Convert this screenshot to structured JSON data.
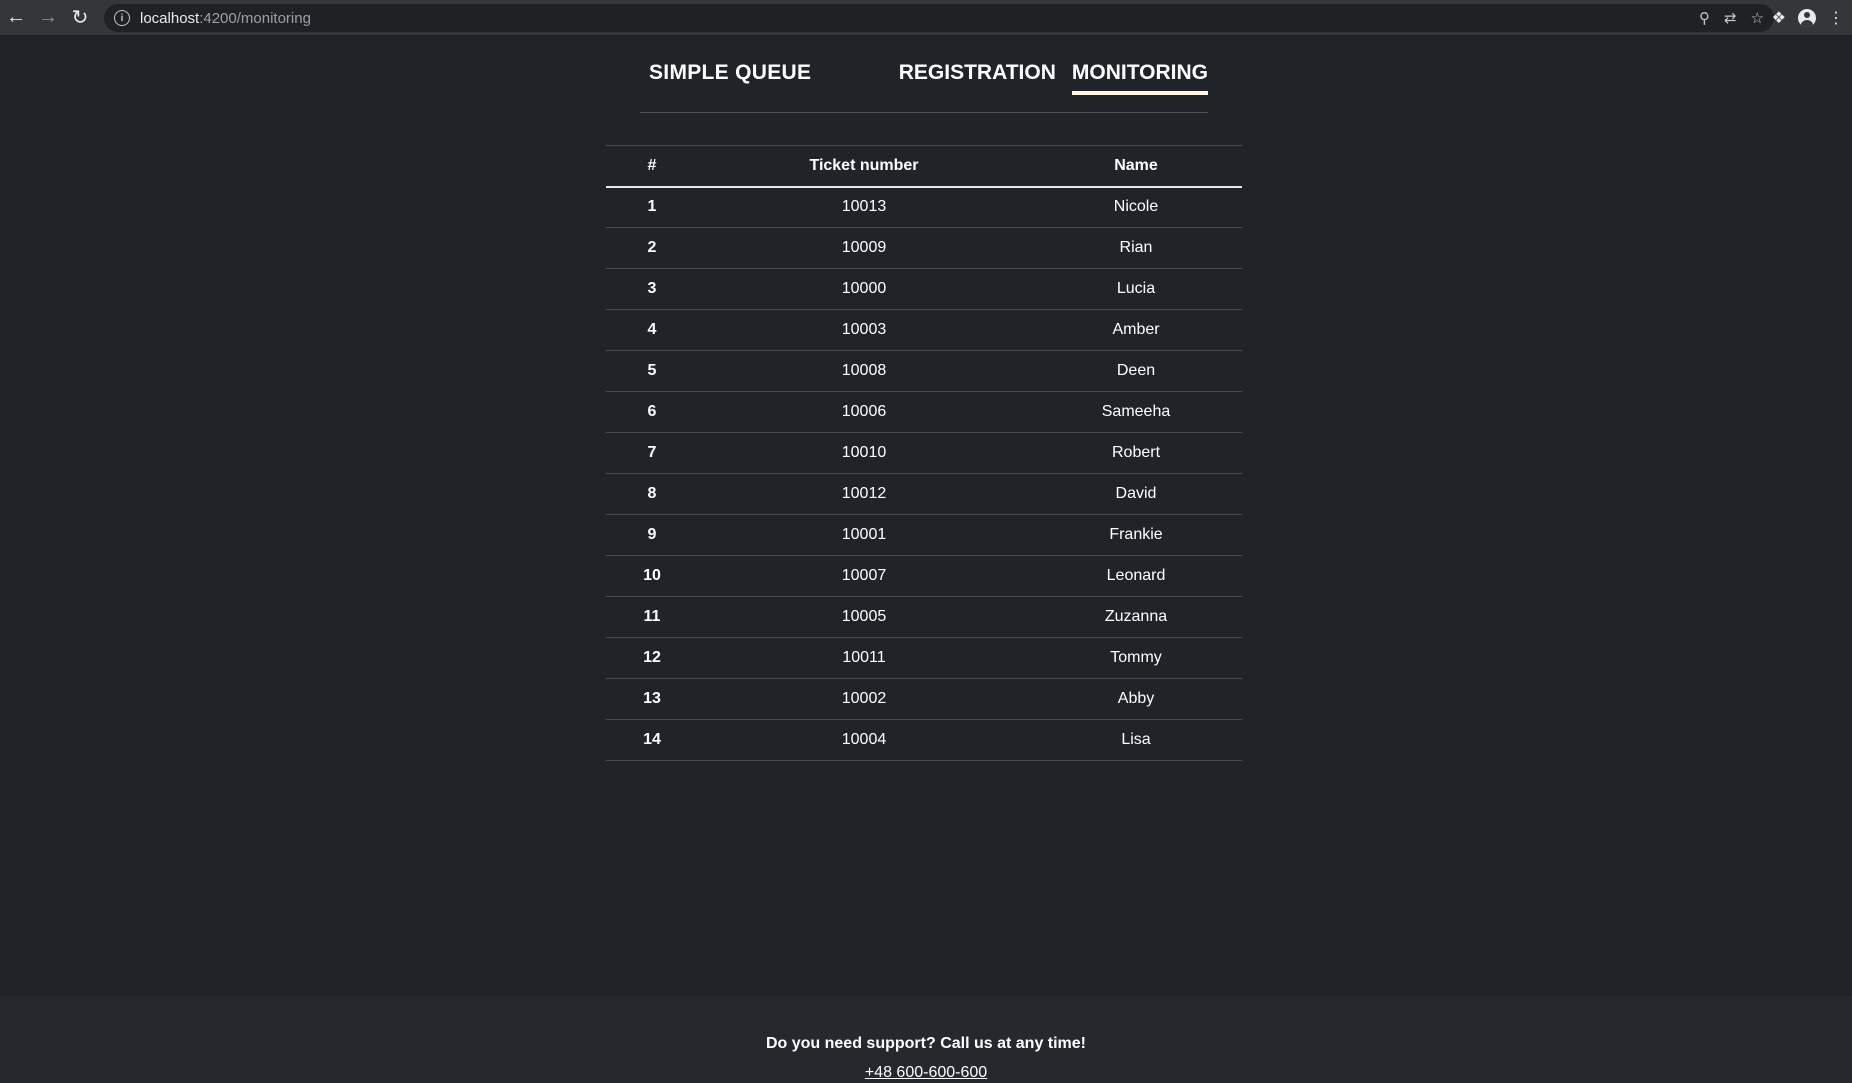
{
  "browser": {
    "url_host": "localhost",
    "url_rest": ":4200/monitoring"
  },
  "header": {
    "brand": "SIMPLE QUEUE",
    "nav": [
      {
        "label": "REGISTRATION",
        "active": false
      },
      {
        "label": "MONITORING",
        "active": true
      }
    ]
  },
  "table": {
    "columns": [
      "#",
      "Ticket number",
      "Name"
    ],
    "rows": [
      {
        "rank": "1",
        "ticket": "10013",
        "name": "Nicole"
      },
      {
        "rank": "2",
        "ticket": "10009",
        "name": "Rian"
      },
      {
        "rank": "3",
        "ticket": "10000",
        "name": "Lucia"
      },
      {
        "rank": "4",
        "ticket": "10003",
        "name": "Amber"
      },
      {
        "rank": "5",
        "ticket": "10008",
        "name": "Deen"
      },
      {
        "rank": "6",
        "ticket": "10006",
        "name": "Sameeha"
      },
      {
        "rank": "7",
        "ticket": "10010",
        "name": "Robert"
      },
      {
        "rank": "8",
        "ticket": "10012",
        "name": "David"
      },
      {
        "rank": "9",
        "ticket": "10001",
        "name": "Frankie"
      },
      {
        "rank": "10",
        "ticket": "10007",
        "name": "Leonard"
      },
      {
        "rank": "11",
        "ticket": "10005",
        "name": "Zuzanna"
      },
      {
        "rank": "12",
        "ticket": "10011",
        "name": "Tommy"
      },
      {
        "rank": "13",
        "ticket": "10002",
        "name": "Abby"
      },
      {
        "rank": "14",
        "ticket": "10004",
        "name": "Lisa"
      }
    ]
  },
  "footer": {
    "text": "Do you need support? Call us at any time!",
    "phone": "+48 600-600-600"
  },
  "colors": {
    "background": "#202328",
    "footer_background": "#25282d",
    "active_underline": "#fff6e0"
  }
}
